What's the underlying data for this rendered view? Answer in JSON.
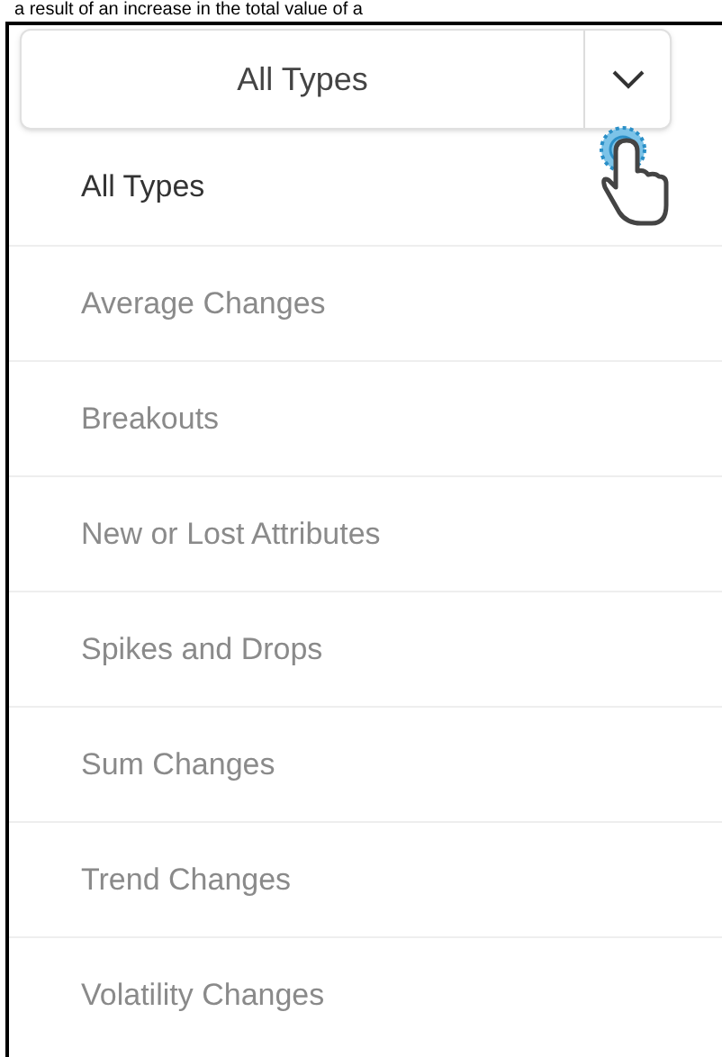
{
  "caption": "a result of an increase in the total value of a",
  "select": {
    "value": "All Types"
  },
  "options": [
    {
      "label": "All Types",
      "selected": true
    },
    {
      "label": "Average Changes",
      "selected": false
    },
    {
      "label": "Breakouts",
      "selected": false
    },
    {
      "label": "New or Lost Attributes",
      "selected": false
    },
    {
      "label": "Spikes and Drops",
      "selected": false
    },
    {
      "label": "Sum Changes",
      "selected": false
    },
    {
      "label": "Trend Changes",
      "selected": false
    },
    {
      "label": "Volatility Changes",
      "selected": false
    }
  ]
}
